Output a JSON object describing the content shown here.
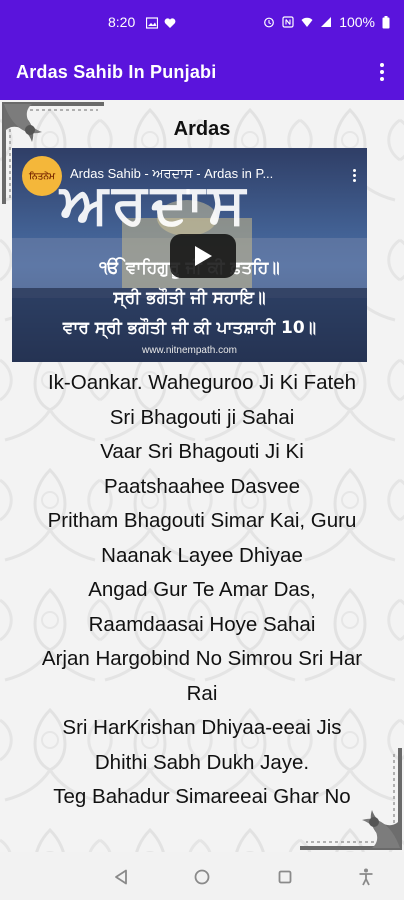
{
  "status_bar": {
    "time": "8:20",
    "battery_text": "100%",
    "icons_left": [
      "gallery-icon",
      "heart-icon"
    ],
    "icons_right": [
      "alarm-icon",
      "nfc-icon",
      "wifi-icon",
      "signal-icon",
      "battery-icon"
    ]
  },
  "app_bar": {
    "title": "Ardas Sahib In Punjabi",
    "menu_icon": "more-vert-icon"
  },
  "content": {
    "heading": "Ardas",
    "video": {
      "title": "Ardas Sahib - ਅਰਦਾਸ - Ardas in P...",
      "channel_logo_text": "ਨਿਤਨੇਮ",
      "big_text": "ਅਰਦਾਸ",
      "lines": [
        "ੴ ਵਾਹਿਗੁਰੂ ਜੀ ਕੀ ਫ਼ਤਹਿ॥",
        "ਸ੍ਰੀ ਭਗੌਤੀ ਜੀ ਸਹਾਇ॥",
        "ਵਾਰ ਸ੍ਰੀ ਭਗੌਤੀ ਜੀ ਕੀ ਪਾਤਸ਼ਾਹੀ 10॥"
      ],
      "url": "www.nitnempath.com"
    },
    "lines": [
      "Ik-Oankar. Waheguroo Ji Ki Fateh",
      "Sri Bhagouti ji Sahai",
      "Vaar Sri Bhagouti Ji Ki",
      "Paatshaahee Dasvee",
      "Pritham Bhagouti Simar Kai, Guru",
      "Naanak Layee Dhiyae",
      "Angad Gur Te Amar Das,",
      "Raamdaasai Hoye Sahai",
      "Arjan Hargobind No Simrou Sri Har",
      "Rai",
      "Sri HarKrishan Dhiyaa-eeai Jis",
      "Dhithi Sabh Dukh Jaye.",
      "Teg Bahadur Simareeai Ghar No"
    ]
  },
  "nav_bar": {
    "buttons": [
      "back-icon",
      "home-icon",
      "recents-icon",
      "accessibility-icon"
    ]
  },
  "colors": {
    "primary": "#5a14dc",
    "background": "#f3f3f3"
  }
}
